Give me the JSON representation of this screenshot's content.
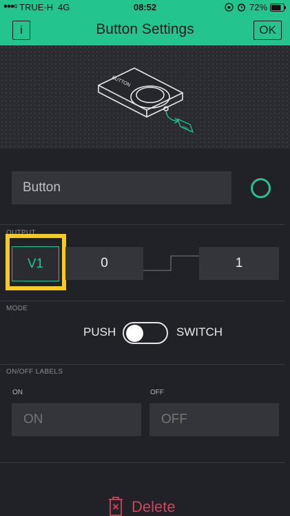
{
  "status_bar": {
    "carrier": "TRUE-H",
    "network": "4G",
    "time": "08:52",
    "battery": "72%"
  },
  "nav": {
    "info_label": "i",
    "title": "Button Settings",
    "ok_label": "OK"
  },
  "preview": {
    "widget_label": "BUTTON",
    "pin_label": "PIN"
  },
  "name_field": {
    "value": "Button",
    "color": "#23c48e"
  },
  "output": {
    "section_label": "OUTPUT",
    "pin": "V1",
    "min": "0",
    "max": "1"
  },
  "mode": {
    "section_label": "MODE",
    "push_label": "PUSH",
    "switch_label": "SWITCH",
    "is_switch": false
  },
  "labels": {
    "section_label": "ON/OFF LABELS",
    "on_caption": "ON",
    "off_caption": "OFF",
    "on_placeholder": "ON",
    "off_placeholder": "OFF"
  },
  "delete_label": "Delete",
  "colors": {
    "accent": "#23c48e",
    "highlight": "#f4cb25",
    "danger": "#d3435c",
    "background": "#212227",
    "field": "#34353a"
  }
}
